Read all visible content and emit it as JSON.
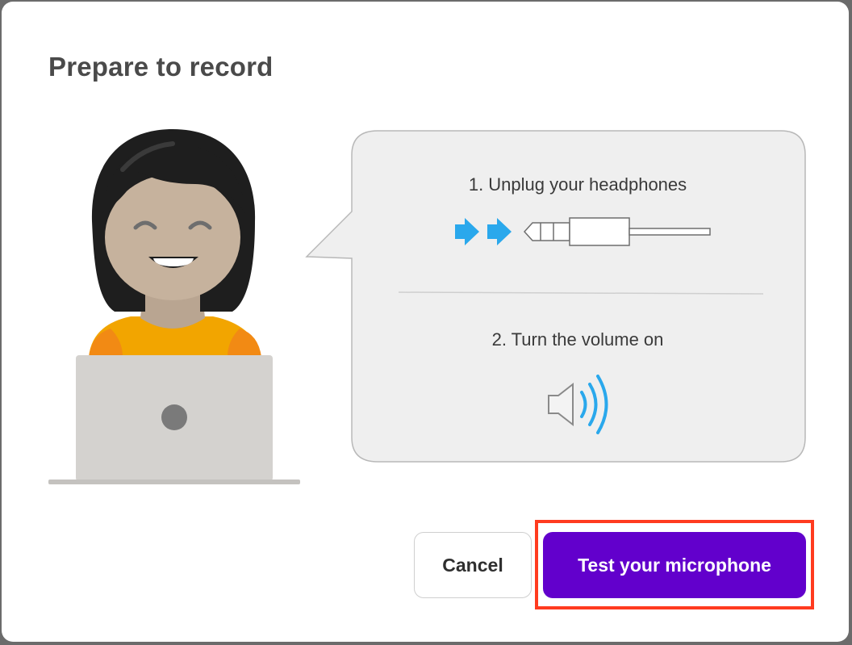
{
  "dialog": {
    "title": "Prepare to record",
    "steps": [
      {
        "label": "1. Unplug your headphones",
        "icon": "headphone-plug-icon"
      },
      {
        "label": "2. Turn the volume on",
        "icon": "speaker-volume-icon"
      }
    ],
    "illustration": "person-with-laptop",
    "buttons": {
      "cancel_label": "Cancel",
      "primary_label": "Test your microphone"
    }
  },
  "colors": {
    "primary": "#6200cc",
    "highlight": "#ff3b1f",
    "accent_blue": "#2aa8ec",
    "bubble_bg": "#efefef"
  }
}
